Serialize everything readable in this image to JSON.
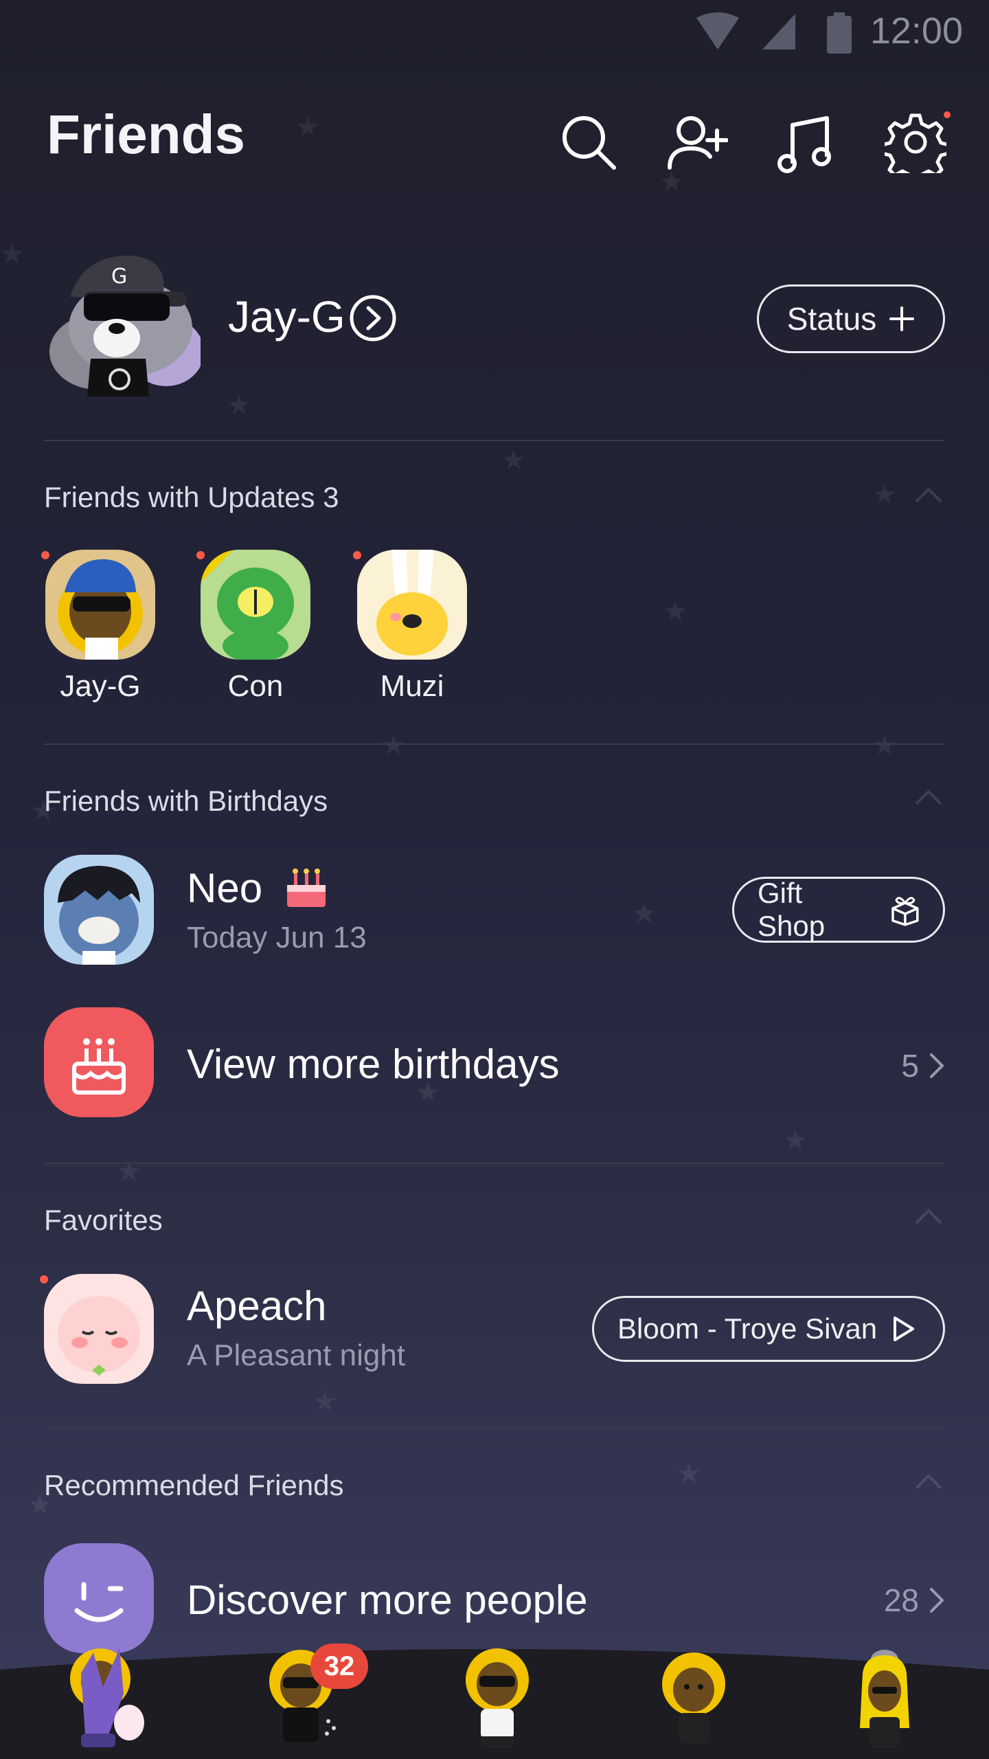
{
  "status_bar": {
    "time": "12:00"
  },
  "header": {
    "title": "Friends"
  },
  "profile": {
    "name": "Jay-G",
    "status_button": "Status"
  },
  "updates": {
    "title": "Friends with Updates 3",
    "items": [
      {
        "name": "Jay-G"
      },
      {
        "name": "Con"
      },
      {
        "name": "Muzi"
      }
    ]
  },
  "birthdays": {
    "title": "Friends with Birthdays",
    "friend": {
      "name": "Neo",
      "date": "Today Jun 13",
      "button": "Gift Shop"
    },
    "more": {
      "label": "View more birthdays",
      "count": "5"
    }
  },
  "favorites": {
    "title": "Favorites",
    "friend": {
      "name": "Apeach",
      "status": "A Pleasant night",
      "music": "Bloom - Troye Sivan"
    }
  },
  "recommended": {
    "title": "Recommended Friends",
    "discover": {
      "label": "Discover more people",
      "count": "28"
    }
  },
  "tabs": {
    "chats_badge": "32"
  },
  "colors": {
    "accent_red": "#e8483c",
    "birthday_red": "#f05a5f",
    "discover_purple": "#8e7ad0",
    "notification_dot": "#ff5a4a"
  }
}
